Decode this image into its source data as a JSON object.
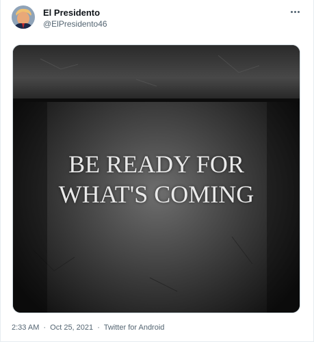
{
  "tweet": {
    "author": {
      "display_name": "El Presidento",
      "handle": "@ElPresidento46",
      "avatar_icon": "profile-avatar"
    },
    "more_icon": "more-horizontal-icon",
    "image": {
      "line1": "BE READY FOR",
      "line2": "WHAT'S COMING"
    },
    "meta": {
      "time": "2:33 AM",
      "date": "Oct 25, 2021",
      "source": "Twitter for Android",
      "separator": "·"
    }
  },
  "colors": {
    "secondary_text": "#536471",
    "primary_text": "#0f1419",
    "border": "#cfd9de"
  }
}
